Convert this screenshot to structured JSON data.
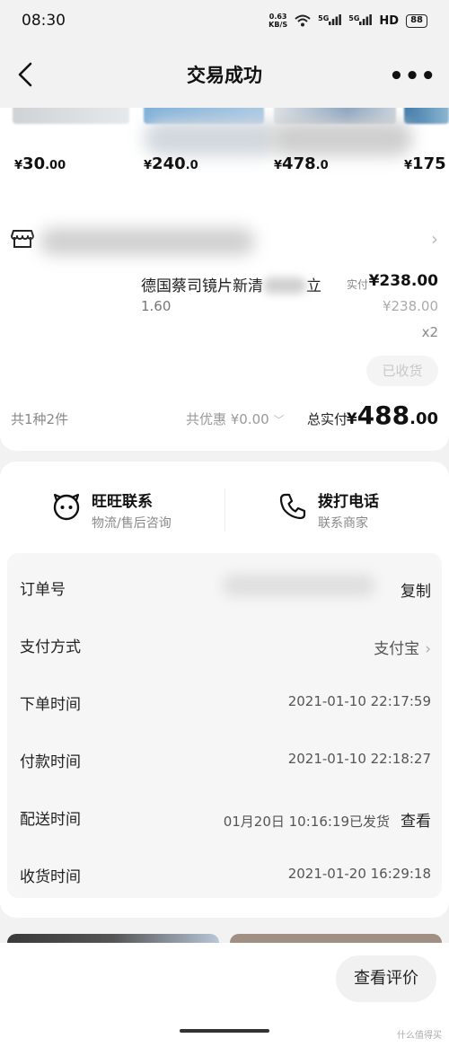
{
  "status_bar": {
    "time": "08:30",
    "net_speed_value": "0.63",
    "net_speed_unit": "KB/S",
    "signal1": "5G",
    "signal2": "5G",
    "hd": "HD",
    "battery": "88"
  },
  "nav": {
    "title": "交易成功",
    "more": "•••"
  },
  "recommend": {
    "prices": [
      {
        "symbol": "¥",
        "int": "30",
        "dec": ".00"
      },
      {
        "symbol": "¥",
        "int": "240",
        "dec": ".0"
      },
      {
        "symbol": "¥",
        "int": "478",
        "dec": ".0"
      },
      {
        "symbol": "¥",
        "int": "175",
        "dec": ""
      }
    ]
  },
  "order": {
    "product_name": "德国蔡司镜片新清",
    "product_name_tail": "立",
    "spec": "1.60",
    "paid_label": "实付",
    "paid_amount": "¥238.00",
    "original_price": "¥238.00",
    "quantity": "x2",
    "received_button": "已收货",
    "summary_count": "共1种2件",
    "summary_discount": "共优惠 ¥0.00",
    "summary_total_label": "总实付",
    "summary_total_currency": "¥",
    "summary_total_int": "488",
    "summary_total_dec": ".00"
  },
  "contact": {
    "wangwang_title": "旺旺联系",
    "wangwang_sub": "物流/售后咨询",
    "phone_title": "拨打电话",
    "phone_sub": "联系商家"
  },
  "info": {
    "order_no_label": "订单号",
    "copy_action": "复制",
    "payment_label": "支付方式",
    "payment_value": "支付宝",
    "order_time_label": "下单时间",
    "order_time_value": "2021-01-10 22:17:59",
    "pay_time_label": "付款时间",
    "pay_time_value": "2021-01-10 22:18:27",
    "ship_time_label": "配送时间",
    "ship_time_value": "01月20日 10:16:19已发货",
    "view_action": "查看",
    "receive_time_label": "收货时间",
    "receive_time_value": "2021-01-20 16:29:18"
  },
  "bottom": {
    "review_button": "查看评价",
    "watermark": "什么值得买"
  }
}
